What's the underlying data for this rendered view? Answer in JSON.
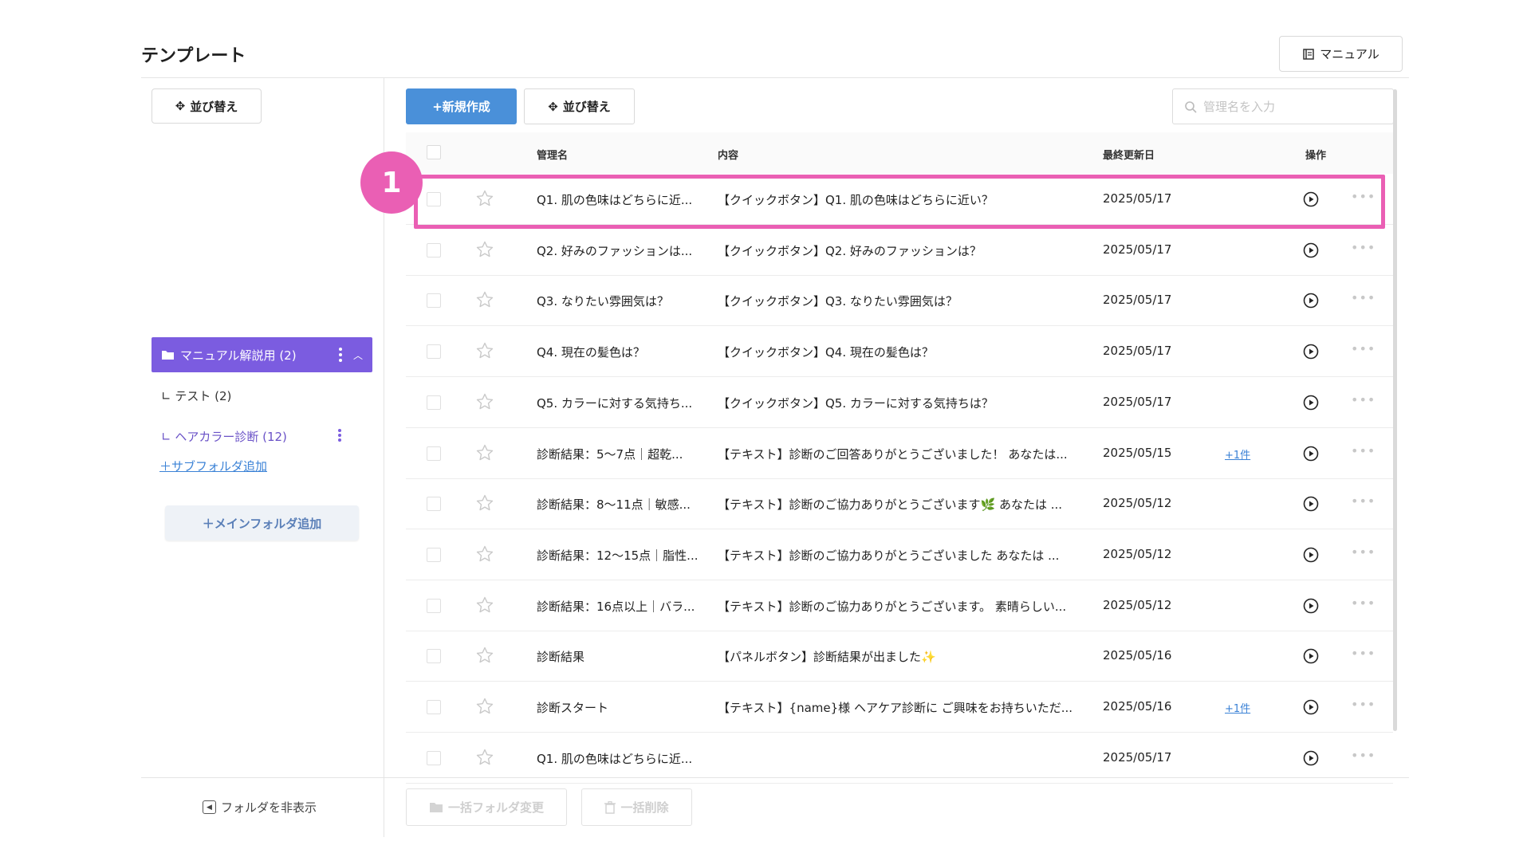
{
  "page": {
    "title": "テンプレート"
  },
  "header": {
    "manual_label": "マニュアル"
  },
  "sidebar": {
    "sort_label": "並び替え",
    "active_folder": {
      "label": "マニュアル解説用 (2)"
    },
    "subfolders": [
      {
        "label": "∟ テスト (2)"
      },
      {
        "label": "∟ ヘアカラー診断 (12)"
      }
    ],
    "add_subfolder_label": "＋サブフォルダ追加",
    "add_mainfolder_label": "＋メインフォルダ追加",
    "hide_folder_label": "フォルダを非表示"
  },
  "toolbar": {
    "new_label": "+新規作成",
    "sort_label": "並び替え",
    "search_placeholder": "管理名を入力"
  },
  "table": {
    "headers": {
      "name": "管理名",
      "content": "内容",
      "updated": "最終更新日",
      "actions": "操作"
    },
    "rows": [
      {
        "name": "Q1. 肌の色味はどちらに近...",
        "content": "【クイックボタン】Q1. 肌の色味はどちらに近い？",
        "date": "2025/05/17",
        "extra": ""
      },
      {
        "name": "Q2. 好みのファッションは...",
        "content": "【クイックボタン】Q2. 好みのファッションは？",
        "date": "2025/05/17",
        "extra": ""
      },
      {
        "name": "Q3. なりたい雰囲気は？",
        "content": "【クイックボタン】Q3. なりたい雰囲気は？",
        "date": "2025/05/17",
        "extra": ""
      },
      {
        "name": "Q4. 現在の髪色は？",
        "content": "【クイックボタン】Q4. 現在の髪色は？",
        "date": "2025/05/17",
        "extra": ""
      },
      {
        "name": "Q5. カラーに対する気持ち...",
        "content": "【クイックボタン】Q5. カラーに対する気持ちは？",
        "date": "2025/05/17",
        "extra": ""
      },
      {
        "name": "診断結果：5〜7点｜超乾...",
        "content": "【テキスト】診断のご回答ありがとうございました！ あなたは...",
        "date": "2025/05/15",
        "extra": "+1件"
      },
      {
        "name": "診断結果：8〜11点｜敏感...",
        "content": "【テキスト】診断のご協力ありがとうございます🌿 あなたは ...",
        "date": "2025/05/12",
        "extra": ""
      },
      {
        "name": "診断結果：12〜15点｜脂性...",
        "content": "【テキスト】診断のご協力ありがとうございました あなたは ...",
        "date": "2025/05/12",
        "extra": ""
      },
      {
        "name": "診断結果：16点以上｜バラ...",
        "content": "【テキスト】診断のご協力ありがとうございます。 素晴らしい...",
        "date": "2025/05/12",
        "extra": ""
      },
      {
        "name": "診断結果",
        "content": "【パネルボタン】診断結果が出ました✨",
        "date": "2025/05/16",
        "extra": ""
      },
      {
        "name": "診断スタート",
        "content": "【テキスト】{name}様 ヘアケア診断に ご興味をお持ちいただ...",
        "date": "2025/05/16",
        "extra": "+1件"
      },
      {
        "name": "Q1. 肌の色味はどちらに近...",
        "content": "",
        "date": "2025/05/17",
        "extra": ""
      }
    ]
  },
  "annotation": {
    "badge_number": "1"
  },
  "bottom": {
    "bulk_folder_label": "一括フォルダ変更",
    "bulk_delete_label": "一括削除"
  },
  "colors": {
    "accent_purple": "#7b5ce0",
    "primary_blue": "#4a90d9",
    "highlight_pink": "#ea5fb4",
    "link_blue": "#3b82d6"
  }
}
